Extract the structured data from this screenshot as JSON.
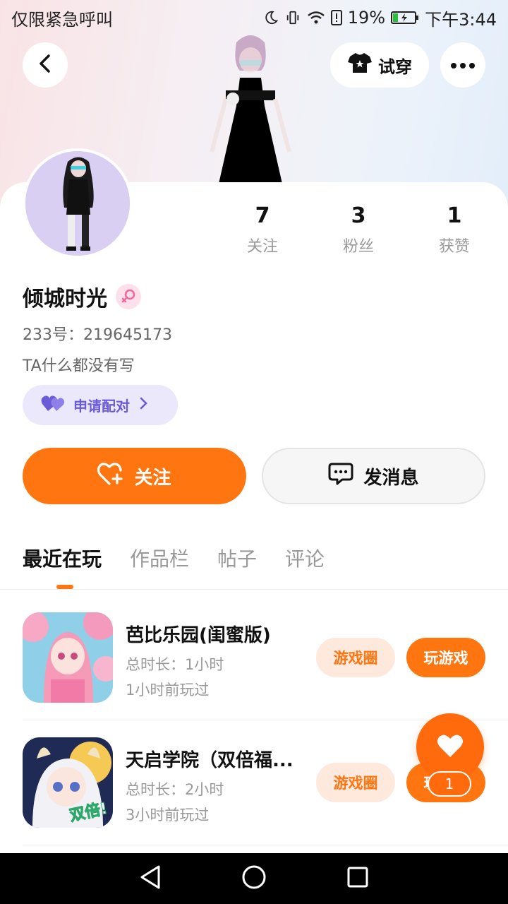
{
  "status_bar": {
    "left_text": "仅限紧急呼叫",
    "battery_percent": "19%",
    "time": "下午3:44"
  },
  "header": {
    "tryon_label": "试穿"
  },
  "profile": {
    "nickname": "倾城时光",
    "id_line": "233号：219645173",
    "bio": "TA什么都没有写",
    "pair_label": "申请配对",
    "stats": [
      {
        "value": "7",
        "label": "关注"
      },
      {
        "value": "3",
        "label": "粉丝"
      },
      {
        "value": "1",
        "label": "获赞"
      }
    ]
  },
  "actions": {
    "follow_label": "关注",
    "message_label": "发消息"
  },
  "tabs": [
    "最近在玩",
    "作品栏",
    "帖子",
    "评论"
  ],
  "games": [
    {
      "name": "芭比乐园(闺蜜版)",
      "duration": "总时长：1小时",
      "last_played": "1小时前玩过",
      "circle_label": "游戏圈",
      "play_label": "玩游戏"
    },
    {
      "name": "天启学院（双倍福...",
      "duration": "总时长：2小时",
      "last_played": "3小时前玩过",
      "circle_label": "游戏圈",
      "play_label": "玩游戏",
      "icon_text": "双倍!"
    }
  ],
  "fab": {
    "badge_count": "1"
  },
  "colors": {
    "accent": "#ff7510",
    "pair_purple": "#6a5bd6"
  }
}
